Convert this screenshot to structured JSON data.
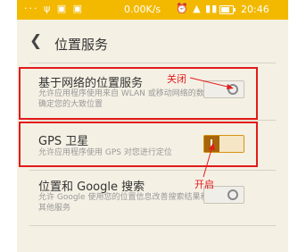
{
  "statusbar": {
    "left_icons": "··· ψ ▣ ▣",
    "speed": "0.00K/s",
    "icons": "⏰ ▲ ▮▮",
    "time": "20:46"
  },
  "header": {
    "title": "位置服务"
  },
  "settings": [
    {
      "title": "基于网络的位置服务",
      "desc": "允许应用程序使用来自 WLAN 或移动网络的数据确定您的大致位置",
      "state": "off"
    },
    {
      "title": "GPS 卫星",
      "desc": "允许应用程序使用 GPS 对您进行定位",
      "state": "on"
    },
    {
      "title": "位置和 Google 搜索",
      "desc": "允许 Google 使用您的位置信息改善搜索结果和其他服务",
      "state": "off"
    }
  ],
  "annotations": {
    "off_label": "关闭",
    "on_label": "开启"
  },
  "colors": {
    "statusbar": "#f3b900",
    "annotation": "#e21b1b",
    "toggle_on": "#e9a21a"
  }
}
